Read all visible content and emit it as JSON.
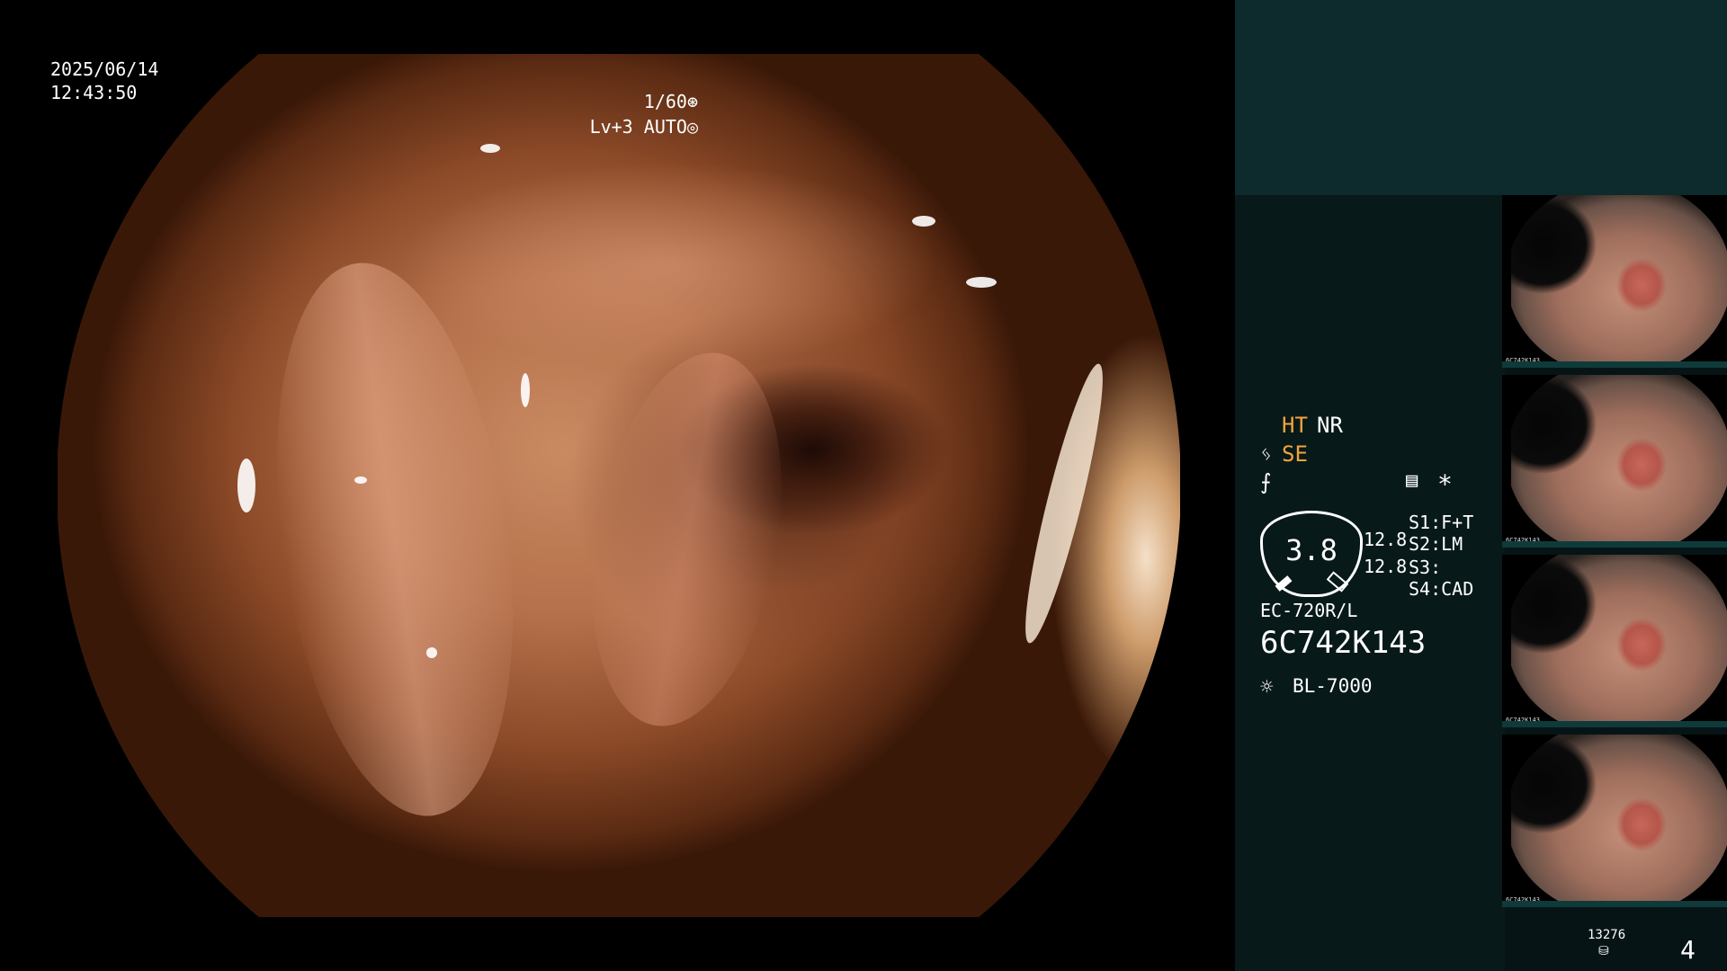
{
  "viewer": {
    "date": "2025/06/14",
    "time": "12:43:50",
    "shutter": "1/60",
    "level": "Lv+3",
    "mode": "AUTO"
  },
  "panel": {
    "ht": "HT",
    "nr": "NR",
    "se": "SE",
    "ratio_value": "3.8",
    "ratio_side_1": "12.8",
    "ratio_side_2": "12.8",
    "s1": "S1:F+T",
    "s2": "S2:LM",
    "s3": "S3:",
    "s4": "S4:CAD",
    "scope_model": "EC-720R/L",
    "serial": "6C742K143",
    "light_source": "BL-7000",
    "storage_count": "13276",
    "page_number": "4"
  },
  "thumbnails": [
    {
      "caption": "6C742K143"
    },
    {
      "caption": "6C742K143"
    },
    {
      "caption": "6C742K143"
    },
    {
      "caption": "6C742K143"
    }
  ],
  "icons": {
    "shutter_icon": "aperture-icon",
    "mode_icon": "auto-icon",
    "se_icon": "se-icon",
    "freeze_icon": "freeze-icon",
    "menu_icon": "menu-icon",
    "asterisk_icon": "asterisk-icon",
    "light_icon": "light-bulb-icon",
    "disk_icon": "storage-icon"
  },
  "colors": {
    "panel_bg": "#071416",
    "header_bg": "#0d2a2c",
    "accent_orange": "#f3a43a"
  }
}
